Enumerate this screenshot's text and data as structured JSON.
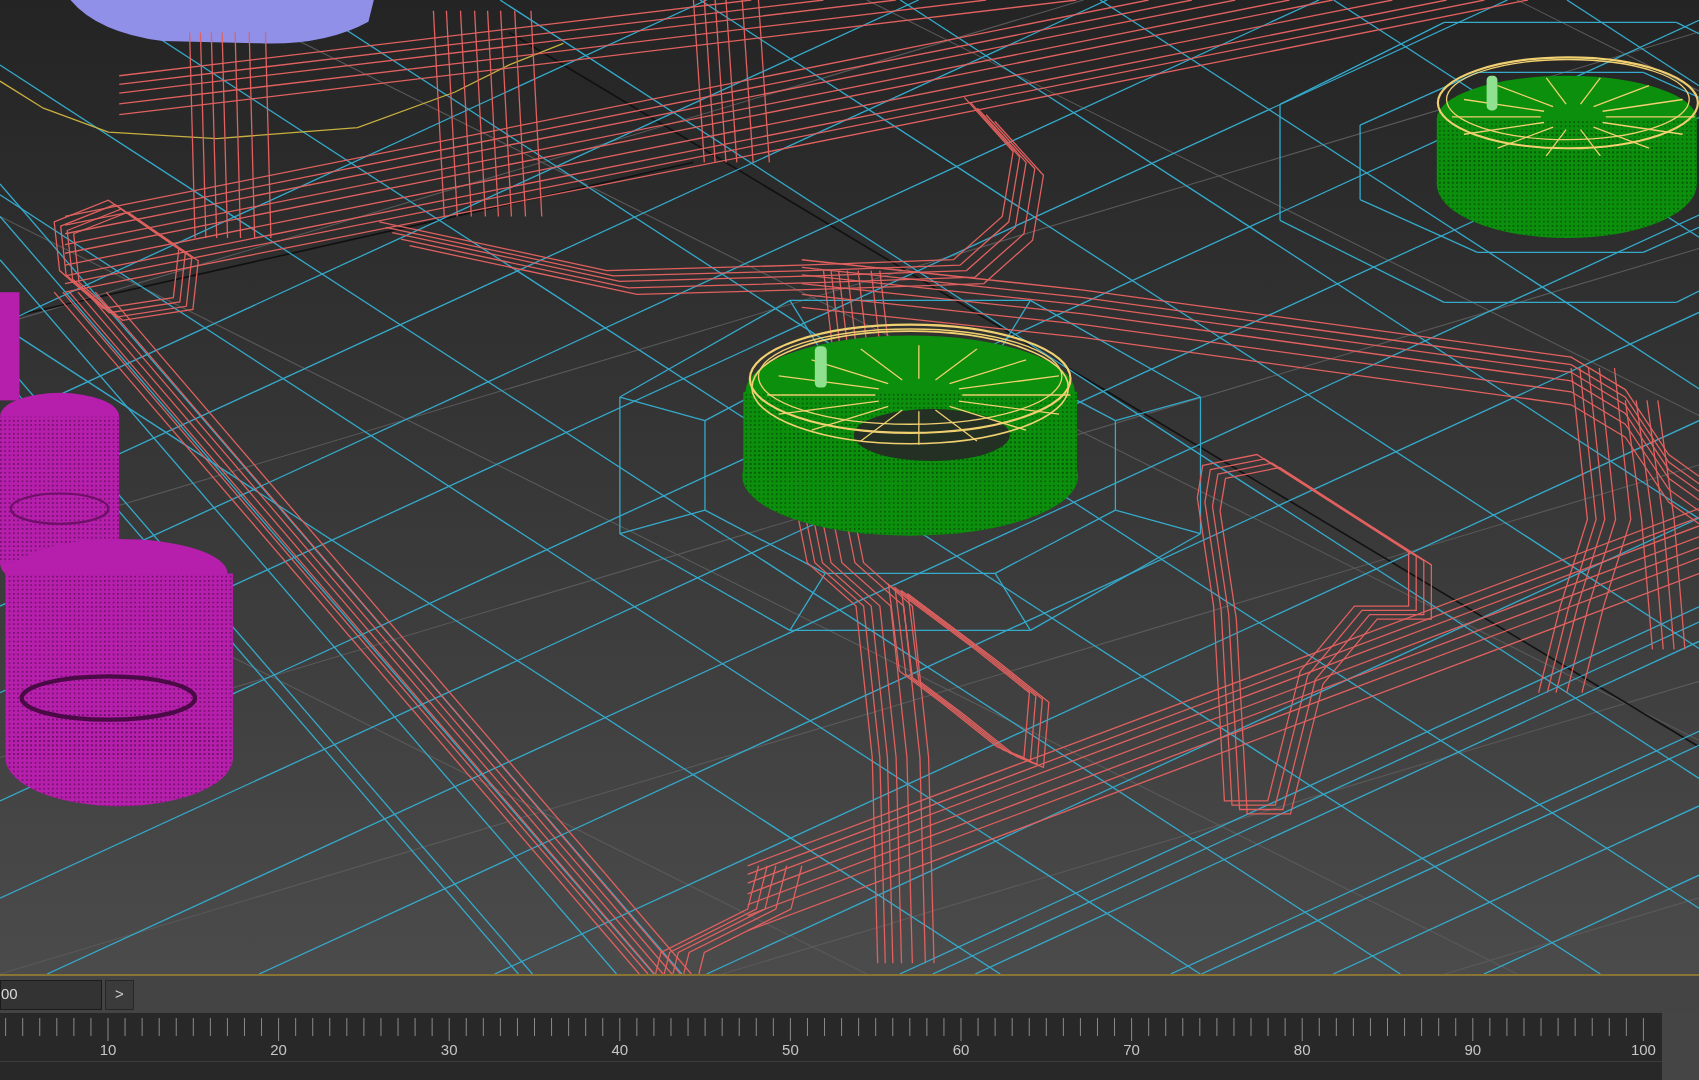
{
  "time_slider": {
    "level": 0,
    "thumb_label": "00",
    "next_button": ">"
  },
  "track_bar": {
    "frame_labels": [
      "10",
      "20",
      "30",
      "40",
      "50",
      "60",
      "70",
      "80",
      "90",
      "100"
    ]
  }
}
